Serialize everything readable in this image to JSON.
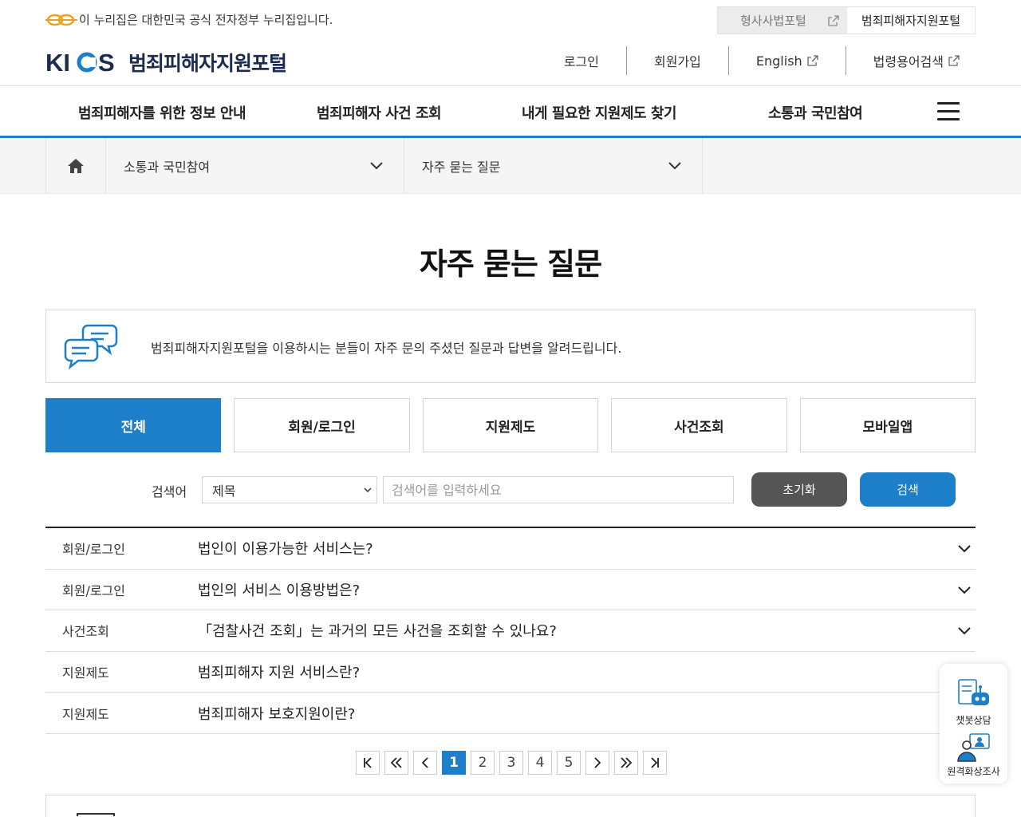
{
  "gov": {
    "notice": "이 누리집은 대한민국 공식 전자정부 누리집입니다.",
    "portals": [
      "형사사법포털",
      "범죄피해자지원포털"
    ]
  },
  "header": {
    "brand_logo": "KICS",
    "brand_name": "범죄피해자지원포털",
    "util": {
      "login": "로그인",
      "signup": "회원가입",
      "english": "English",
      "law_terms": "법령용어검색"
    }
  },
  "gnb": [
    "범죄피해자를 위한 정보 안내",
    "범죄피해자 사건 조회",
    "내게 필요한 지원제도 찾기",
    "소통과 국민참여"
  ],
  "breadcrumb": {
    "level1": "소통과 국민참여",
    "level2": "자주 묻는 질문"
  },
  "page": {
    "title": "자주 묻는 질문",
    "intro": "범죄피해자지원포털을 이용하시는 분들이 자주 문의 주셨던 질문과 답변을 알려드립니다."
  },
  "tabs": [
    "전체",
    "회원/로그인",
    "지원제도",
    "사건조회",
    "모바일앱"
  ],
  "search": {
    "label": "검색어",
    "field_selected": "제목",
    "placeholder": "검색어를 입력하세요",
    "reset": "초기화",
    "submit": "검색"
  },
  "faq": [
    {
      "category": "회원/로그인",
      "question": "법인이 이용가능한 서비스는?"
    },
    {
      "category": "회원/로그인",
      "question": "법인의 서비스 이용방법은?"
    },
    {
      "category": "사건조회",
      "question": "「검찰사건 조회」는 과거의 모든 사건을 조회할 수 있나요?"
    },
    {
      "category": "지원제도",
      "question": "범죄피해자 지원 서비스란?"
    },
    {
      "category": "지원제도",
      "question": "범죄피해자 보호지원이란?"
    }
  ],
  "pagination": {
    "pages": [
      "1",
      "2",
      "3",
      "4",
      "5"
    ],
    "current": "1"
  },
  "quick": {
    "chatbot": "챗봇상담",
    "remote": "원격화상조사"
  },
  "colors": {
    "primary": "#1d7fc9",
    "dark_button": "#555555",
    "brand_navy": "#1d2b4f"
  }
}
